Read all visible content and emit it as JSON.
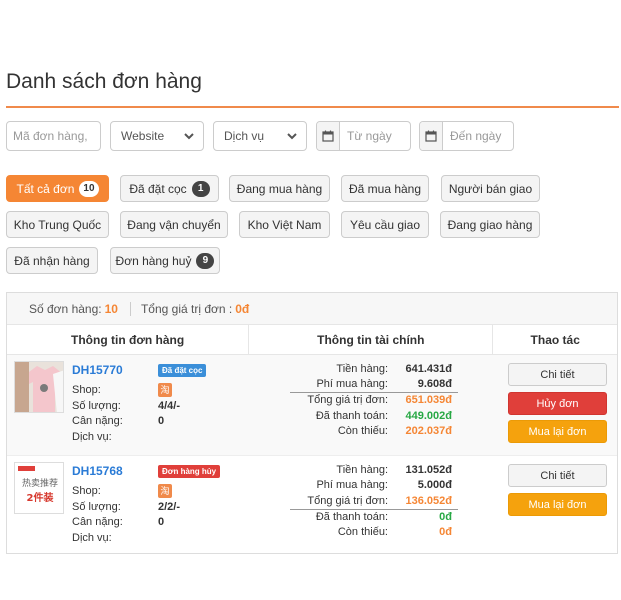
{
  "page": {
    "title": "Danh sách đơn hàng"
  },
  "filters": {
    "order_code_placeholder": "Mã đơn hàng,",
    "website_value": "Website",
    "service_value": "Dịch vụ",
    "from_placeholder": "Từ ngày",
    "to_placeholder": "Đến ngày"
  },
  "status_tabs": [
    {
      "label": "Tất cả đơn",
      "count": "10",
      "active": true
    },
    {
      "label": "Đã đặt cọc",
      "count": "1"
    },
    {
      "label": "Đang mua hàng"
    },
    {
      "label": "Đã mua hàng"
    },
    {
      "label": "Người bán giao"
    },
    {
      "label": "Kho Trung Quốc"
    },
    {
      "label": "Đang vận chuyển"
    },
    {
      "label": "Kho Việt Nam"
    },
    {
      "label": "Yêu cầu giao"
    },
    {
      "label": "Đang giao hàng"
    },
    {
      "label": "Đã nhận hàng"
    },
    {
      "label": "Đơn hàng huỷ",
      "count": "9"
    }
  ],
  "summary": {
    "order_count_label": "Số đơn hàng:",
    "order_count": "10",
    "total_label": "Tổng giá trị đơn :",
    "total_value": "0đ"
  },
  "table": {
    "headers": [
      "Thông tin đơn hàng",
      "Thông tin tài chính",
      "Thao tác"
    ]
  },
  "orders": [
    {
      "id": "DH15770",
      "status": "Đã đặt cọc",
      "status_color": "#3b8fd9",
      "shop_label": "Shop:",
      "shop_icon": "淘",
      "qty_label": "Số lượng:",
      "qty": "4/4/-",
      "weight_label": "Cân nặng:",
      "weight": "0",
      "service_label": "Dịch vụ:",
      "finance": {
        "goods_label": "Tiền hàng:",
        "goods": "641.431đ",
        "fee_label": "Phí mua hàng:",
        "fee": "9.608đ",
        "total_label": "Tổng giá trị đơn:",
        "total": "651.039đ",
        "paid_label": "Đã thanh toán:",
        "paid": "449.002đ",
        "remain_label": "Còn thiếu:",
        "remain": "202.037đ"
      },
      "actions": {
        "detail": "Chi tiết",
        "cancel": "Hủy đơn",
        "rebuy": "Mua lại đơn"
      }
    },
    {
      "id": "DH15768",
      "status": "Đơn hàng hủy",
      "status_color": "#e03f3a",
      "shop_label": "Shop:",
      "shop_icon": "淘",
      "qty_label": "Số lượng:",
      "qty": "2/2/-",
      "weight_label": "Cân nặng:",
      "weight": "0",
      "service_label": "Dịch vụ:",
      "thumb_text": "热卖推荐",
      "thumb_text2": "2件装",
      "finance": {
        "goods_label": "Tiền hàng:",
        "goods": "131.052đ",
        "fee_label": "Phí mua hàng:",
        "fee": "5.000đ",
        "total_label": "Tổng giá trị đơn:",
        "total": "136.052đ",
        "paid_label": "Đã thanh toán:",
        "paid": "0đ",
        "remain_label": "Còn thiếu:",
        "remain": "0đ"
      },
      "actions": {
        "detail": "Chi tiết",
        "rebuy": "Mua lại đơn"
      }
    }
  ]
}
